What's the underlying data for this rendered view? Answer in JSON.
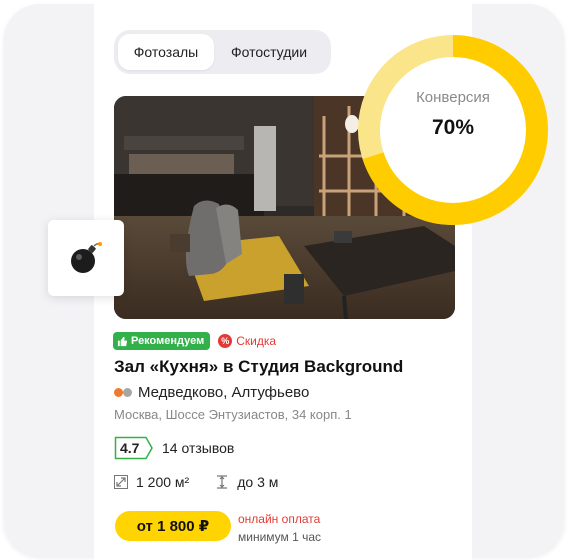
{
  "tabs": [
    {
      "label": "Фотозалы",
      "active": true
    },
    {
      "label": "Фотостудии",
      "active": false
    }
  ],
  "conversion": {
    "label": "Конверсия",
    "value_text": "70%",
    "value": 0.7,
    "color_fill": "#ffcc00",
    "color_track": "#fbe58a"
  },
  "bomb_icon": "bomb-icon",
  "listing": {
    "badge_recommended": "Рекомендуем",
    "badge_sale": "Скидка",
    "title": "Зал «Кухня» в Студия Background",
    "metro": "Медведково, Алтуфьево",
    "metro_colors": [
      "#f07a2c",
      "#a6a6a6"
    ],
    "address": "Москва, Шоссе Энтузиастов, 34 корп. 1",
    "rating": "4.7",
    "reviews": "14 отзывов",
    "area": "1 200 м²",
    "height": "до 3 м",
    "price": "от 1 800 ₽",
    "payment": "онлайн оплата",
    "minimum": "минимум 1 час"
  },
  "colors": {
    "accent_yellow": "#ffd400",
    "badge_green": "#32b14a",
    "sale_red": "#e53935"
  }
}
